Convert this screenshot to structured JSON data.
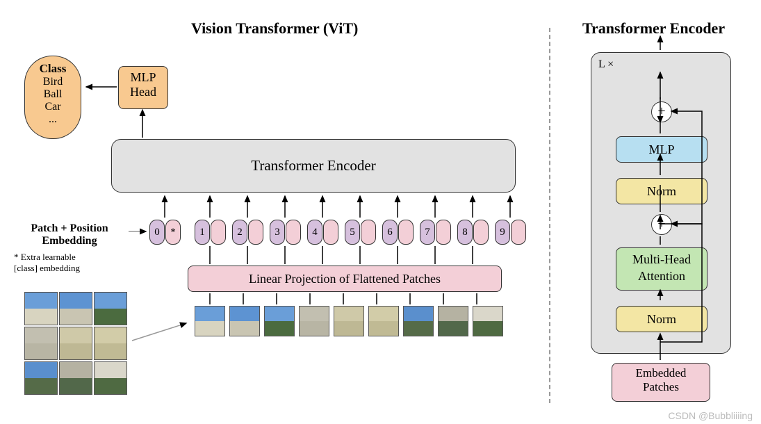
{
  "left_title": "Vision Transformer (ViT)",
  "right_title": "Transformer Encoder",
  "class_box": {
    "heading": "Class",
    "items": [
      "Bird",
      "Ball",
      "Car",
      "..."
    ]
  },
  "mlp_head": {
    "line1": "MLP",
    "line2": "Head"
  },
  "encoder_label": "Transformer Encoder",
  "pp_label": {
    "line1": "Patch + Position",
    "line2": "Embedding"
  },
  "extra_note": "* Extra learnable\n[class] embedding",
  "tokens": [
    "0",
    "1",
    "2",
    "3",
    "4",
    "5",
    "6",
    "7",
    "8",
    "9"
  ],
  "token0_star": "*",
  "lin_proj": "Linear Projection of Flattened Patches",
  "encoder_detail": {
    "lx": "L ×",
    "mlp": "MLP",
    "norm": "Norm",
    "mha": {
      "l1": "Multi-Head",
      "l2": "Attention"
    },
    "plus": "+"
  },
  "embedded_patches": {
    "l1": "Embedded",
    "l2": "Patches"
  },
  "watermark": "CSDN @Bubbliiiing",
  "patch_colors": [
    {
      "sky": "#6a9ed8",
      "gnd": "#d8d4c0"
    },
    {
      "sky": "#5d93d2",
      "gnd": "#c9c5b2"
    },
    {
      "sky": "#6a9ed8",
      "gnd": "#4b6b3f"
    },
    {
      "sky": "#c2bfb0",
      "gnd": "#b8b5a4"
    },
    {
      "sky": "#cfc9a8",
      "gnd": "#beb894"
    },
    {
      "sky": "#d2cca8",
      "gnd": "#c0ba94"
    },
    {
      "sky": "#5a8fcd",
      "gnd": "#556b48"
    },
    {
      "sky": "#b5b2a2",
      "gnd": "#52684a"
    },
    {
      "sky": "#dad7ca",
      "gnd": "#4f6a42"
    }
  ]
}
